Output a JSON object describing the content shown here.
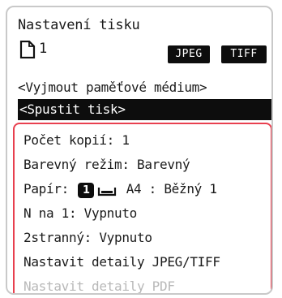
{
  "screen": {
    "title": "Nastavení tisku",
    "page_count": "1",
    "formats": [
      "JPEG",
      "TIFF"
    ]
  },
  "menu": {
    "eject_label": "<Vyjmout paměťové médium>",
    "start_label": "<Spustit tisk>"
  },
  "settings": {
    "copies": "Počet kopií: 1",
    "color_mode": "Barevný režim: Barevný",
    "paper_prefix": "Papír:",
    "paper_drawer": "1",
    "paper_value": "A4 : Běžný 1",
    "n_up": "N na 1: Vypnuto",
    "duplex": "2stranný: Vypnuto",
    "jpeg_tiff_details": "Nastavit detaily JPEG/TIFF",
    "pdf_details": "Nastavit detaily PDF"
  },
  "colors": {
    "highlight_border": "#e8404f",
    "selected_row_bg": "#0d0d0d",
    "disabled_text": "#b8b8b8"
  }
}
